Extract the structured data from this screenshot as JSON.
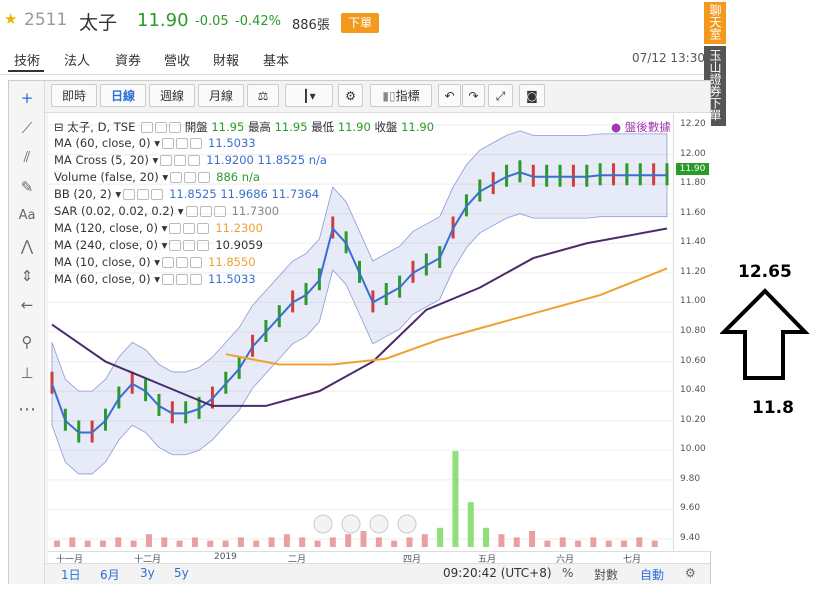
{
  "header": {
    "code": "2511",
    "name": "太子",
    "price": "11.90",
    "change": "-0.05",
    "change_pct": "-0.42%",
    "volume": "886張",
    "order_button": "下單",
    "price_color": "#2a9a2a",
    "star_icon": "star-icon"
  },
  "tabs": [
    "技術",
    "法人",
    "資券",
    "營收",
    "財報",
    "基本"
  ],
  "datetime": "07/12 13:30",
  "side_buttons": {
    "chat": "聊天室",
    "trade": "玉山證券下單"
  },
  "toolbar": {
    "intraday": "即時",
    "daily": "日線",
    "weekly": "週線",
    "monthly": "月線",
    "indicators": "指標"
  },
  "legend": {
    "main": "太子, D, TSE",
    "open_label": "開盤",
    "open": "11.95",
    "high_label": "最高",
    "high": "11.95",
    "low_label": "最低",
    "low": "11.90",
    "close_label": "收盤",
    "close": "11.90",
    "after_hours": "盤後數據",
    "rows": [
      {
        "label": "MA (60, close, 0)",
        "values": "11.5033",
        "color": "#3a6fd0"
      },
      {
        "label": "MA Cross (5, 20)",
        "values": "11.9200  11.8525  n/a",
        "color": "#3a6fd0"
      },
      {
        "label": "Volume (false, 20)",
        "values": "886  n/a",
        "color": "#2a9a2a"
      },
      {
        "label": "BB (20, 2)",
        "values": "11.8525  11.9686  11.7364",
        "color": "#3a6fd0"
      },
      {
        "label": "SAR (0.02, 0.02, 0.2)",
        "values": "11.7300",
        "color": "#888"
      },
      {
        "label": "MA (120, close, 0)",
        "values": "11.2300",
        "color": "#f0a030"
      },
      {
        "label": "MA (240, close, 0)",
        "values": "10.9059",
        "color": "#333"
      },
      {
        "label": "MA (10, close, 0)",
        "values": "11.8550",
        "color": "#f0a030"
      },
      {
        "label": "MA (60, close, 0)",
        "values": "11.5033",
        "color": "#3a6fd0"
      }
    ]
  },
  "chart_data": {
    "type": "line",
    "yticks": [
      "12.20",
      "12.00",
      "11.80",
      "11.60",
      "11.40",
      "11.20",
      "11.00",
      "10.80",
      "10.60",
      "10.40",
      "10.20",
      "10.00",
      "9.80",
      "9.60",
      "9.40"
    ],
    "xticks": [
      "十一月",
      "十二月",
      "2019",
      "二月",
      "四月",
      "五月",
      "六月",
      "七月"
    ],
    "last_price_label": "11.90",
    "ylim": [
      9.4,
      12.2
    ],
    "series": [
      {
        "color": "#3a6fd0",
        "x": [
          0,
          5,
          10,
          15,
          20,
          25,
          30,
          35,
          40,
          45,
          50,
          55,
          60,
          65,
          70,
          75,
          80,
          85,
          90,
          95,
          100,
          105,
          110,
          115,
          120,
          125,
          130,
          135,
          140,
          145,
          150,
          155,
          160,
          165,
          170,
          175,
          180,
          185,
          190,
          195,
          200,
          205,
          210,
          215,
          220,
          225,
          230
        ],
        "y": [
          10.45,
          10.2,
          10.12,
          10.12,
          10.2,
          10.35,
          10.45,
          10.4,
          10.3,
          10.25,
          10.25,
          10.28,
          10.35,
          10.45,
          10.55,
          10.7,
          10.8,
          10.9,
          11.0,
          11.05,
          11.15,
          11.5,
          11.4,
          11.2,
          11.0,
          11.05,
          11.1,
          11.2,
          11.25,
          11.3,
          11.5,
          11.65,
          11.75,
          11.8,
          11.85,
          11.88,
          11.85,
          11.85,
          11.85,
          11.85,
          11.85,
          11.86,
          11.86,
          11.86,
          11.86,
          11.86,
          11.86
        ]
      },
      {
        "color": "#4a2a6a",
        "x": [
          0,
          20,
          40,
          60,
          80,
          100,
          120,
          140,
          160,
          180,
          200,
          230
        ],
        "y": [
          10.85,
          10.6,
          10.45,
          10.3,
          10.3,
          10.4,
          10.6,
          10.95,
          11.1,
          11.3,
          11.4,
          11.5
        ]
      },
      {
        "color": "#f0a030",
        "x": [
          65,
          85,
          105,
          125,
          145,
          165,
          185,
          205,
          230
        ],
        "y": [
          10.65,
          10.58,
          10.58,
          10.62,
          10.75,
          10.85,
          10.95,
          11.05,
          11.23
        ]
      }
    ],
    "volume_values": [
      2,
      3,
      2,
      2,
      3,
      2,
      4,
      3,
      2,
      3,
      2,
      2,
      3,
      2,
      3,
      4,
      3,
      2,
      3,
      4,
      5,
      3,
      2,
      3,
      4,
      6,
      30,
      14,
      6,
      4,
      3,
      5,
      2,
      3,
      2,
      3,
      2,
      2,
      3,
      2
    ]
  },
  "bottom": {
    "ranges": [
      "1日",
      "6月",
      "3y",
      "5y"
    ],
    "clock": "09:20:42 (UTC+8)",
    "percent": "%",
    "log": "對數",
    "auto": "自動"
  },
  "annotation": {
    "upper": "12.65",
    "lower": "11.8"
  }
}
